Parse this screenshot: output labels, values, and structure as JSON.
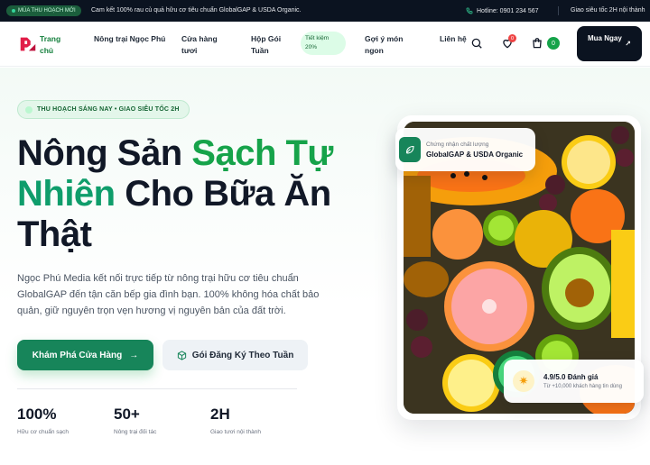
{
  "topbar": {
    "badge": "MÙA THU HOẠCH MỚI",
    "promo": "Cam kết 100% rau củ quả hữu cơ tiêu chuẩn GlobalGAP & USDA Organic.",
    "hotline": "Hotline: 0901 234 567",
    "fast_delivery": "Giao siêu tốc 2H nội thành"
  },
  "nav": {
    "items": [
      {
        "label": "Trang chủ"
      },
      {
        "label": "Nông trại Ngọc Phú"
      },
      {
        "label": "Cửa hàng tươi"
      },
      {
        "label": "Hộp Gói Tuần"
      },
      {
        "label": "Gợi ý món ngon"
      },
      {
        "label": "Liên hệ"
      }
    ],
    "save_pill": "Tiết kiệm 20%",
    "wishlist_count": "0",
    "cart_count": "0",
    "buy_button": "Mua Ngay",
    "icons": {
      "search": "search-icon",
      "wishlist": "heart-icon",
      "cart": "bag-icon",
      "buy": "arrow-up-right-icon"
    }
  },
  "hero": {
    "tag": "THU HOẠCH SÁNG NAY • GIAO SIÊU TỐC 2H",
    "headline_part1": "Nông Sản ",
    "headline_part2": "Sạch Tự",
    "headline_part3": "Nhiên",
    "headline_part4": " Cho Bữa Ăn",
    "headline_part5": "Thật",
    "description": "Ngọc Phú Media kết nối trực tiếp từ nông trại hữu cơ tiêu chuẩn GlobalGAP đến tận căn bếp gia đình bạn. 100% không hóa chất bảo quản, giữ nguyên trọn vẹn hương vị nguyên bản của đất trời.",
    "cta_primary": "Khám Phá Cửa Hàng",
    "cta_secondary": "Gói Đăng Ký Theo Tuần",
    "stats": [
      {
        "value": "100%",
        "label": "Hữu cơ chuẩn sạch"
      },
      {
        "value": "50+",
        "label": "Nông trại đối tác"
      },
      {
        "value": "2H",
        "label": "Giao tươi nội thành"
      }
    ]
  },
  "cert": {
    "line1": "Chứng nhận chất lượng",
    "line2": "GlobalGAP & USDA Organic"
  },
  "rating": {
    "line1": "4.9/5.0 Đánh giá",
    "line2": "Từ +10,000 khách hàng tin dùng"
  },
  "colors": {
    "brand_green": "#17855a",
    "accent_green": "#16a34a",
    "dark": "#0b1320",
    "badge_red": "#ef4444"
  }
}
